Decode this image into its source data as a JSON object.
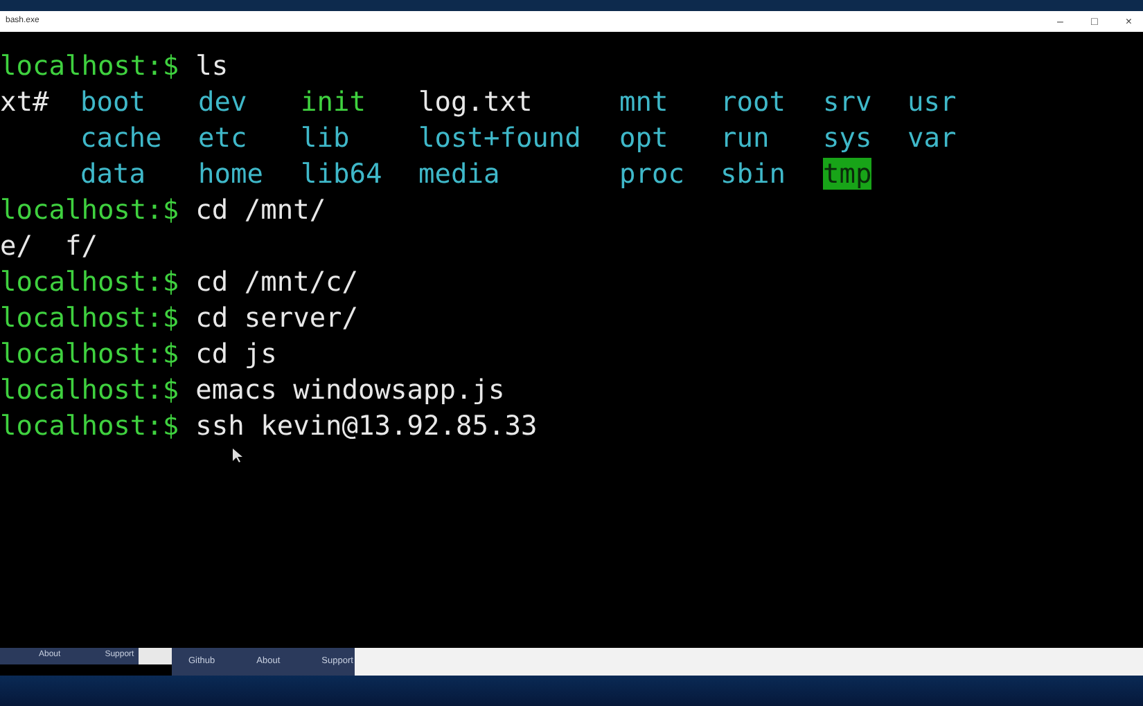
{
  "window": {
    "title": "bash.exe",
    "controls": [
      "–",
      "□",
      "×"
    ]
  },
  "terminal": {
    "lines": [
      {
        "kind": "prompt",
        "prompt": "localhost:$",
        "command": "ls"
      },
      {
        "kind": "listing",
        "cells": [
          {
            "text": "xt#",
            "kind": "plain"
          },
          {
            "text": "boot",
            "kind": "dir"
          },
          {
            "text": "dev",
            "kind": "dir"
          },
          {
            "text": "init",
            "kind": "exec"
          },
          {
            "text": "log.txt",
            "kind": "plain"
          },
          {
            "text": "mnt",
            "kind": "dir"
          },
          {
            "text": "root",
            "kind": "dir"
          },
          {
            "text": "srv",
            "kind": "dir"
          },
          {
            "text": "usr",
            "kind": "dir"
          }
        ]
      },
      {
        "kind": "listing_continued",
        "cells": [
          {
            "text": "cache",
            "kind": "dir"
          },
          {
            "text": "etc",
            "kind": "dir"
          },
          {
            "text": "lib",
            "kind": "dir"
          },
          {
            "text": "lost+found",
            "kind": "dir"
          },
          {
            "text": "opt",
            "kind": "dir"
          },
          {
            "text": "run",
            "kind": "dir"
          },
          {
            "text": "sys",
            "kind": "dir"
          },
          {
            "text": "var",
            "kind": "dir"
          }
        ]
      },
      {
        "kind": "listing_continued",
        "cells": [
          {
            "text": "data",
            "kind": "dir"
          },
          {
            "text": "home",
            "kind": "dir"
          },
          {
            "text": "lib64",
            "kind": "dir"
          },
          {
            "text": "media",
            "kind": "dir"
          },
          {
            "text": "proc",
            "kind": "dir"
          },
          {
            "text": "sbin",
            "kind": "dir"
          },
          {
            "text": "tmp",
            "kind": "sticky"
          }
        ]
      },
      {
        "kind": "prompt",
        "prompt": "localhost:$",
        "command": "cd /mnt/"
      },
      {
        "kind": "output",
        "text": "e/  f/"
      },
      {
        "kind": "prompt",
        "prompt": "localhost:$",
        "command": "cd /mnt/c/"
      },
      {
        "kind": "prompt",
        "prompt": "localhost:$",
        "command": "cd server/"
      },
      {
        "kind": "prompt",
        "prompt": "localhost:$",
        "command": "cd js"
      },
      {
        "kind": "prompt",
        "prompt": "localhost:$",
        "command": "emacs windowsapp.js"
      },
      {
        "kind": "prompt",
        "prompt": "localhost:$",
        "command": "ssh kevin@13.92.85.33"
      }
    ]
  },
  "page_behind": {
    "left_links": [
      "About",
      "Support"
    ],
    "nav_links": [
      "Github",
      "About",
      "Support"
    ]
  }
}
